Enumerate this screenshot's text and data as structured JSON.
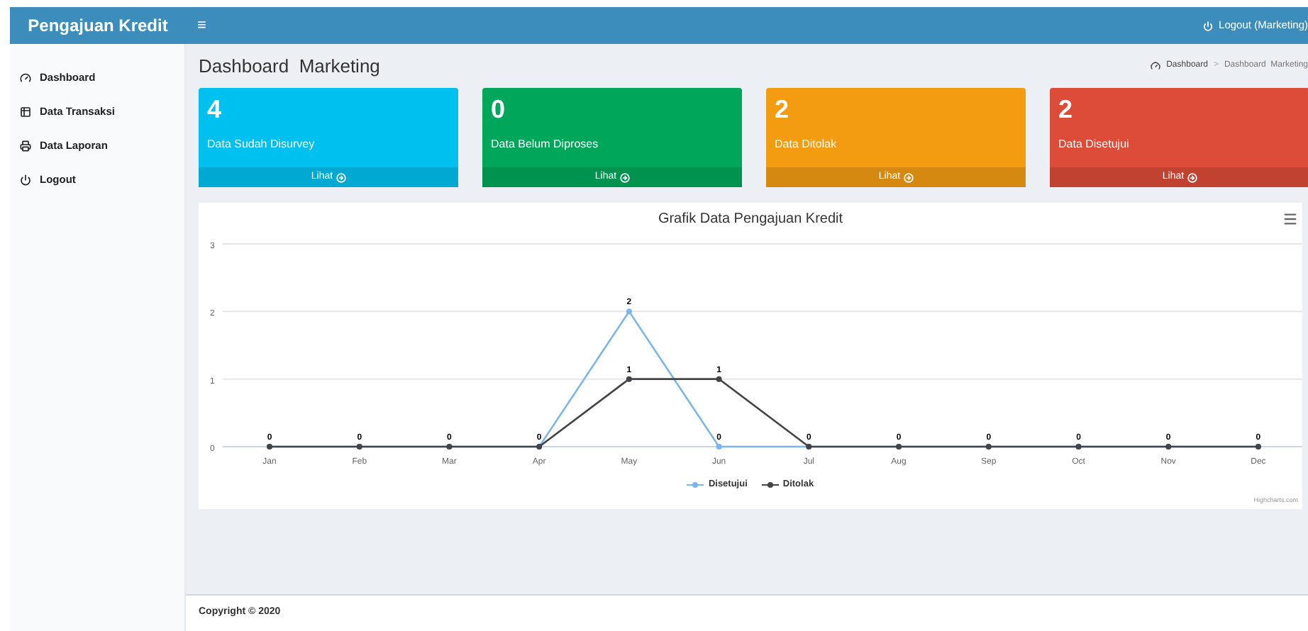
{
  "header": {
    "brand": "Pengajuan Kredit",
    "menu_toggle": "≡",
    "logout": "Logout (Marketing)"
  },
  "sidebar": {
    "items": [
      {
        "label": "Dashboard"
      },
      {
        "label": "Data Transaksi"
      },
      {
        "label": "Data Laporan"
      },
      {
        "label": "Logout"
      }
    ]
  },
  "page": {
    "title": "Dashboard  Marketing",
    "breadcrumb": [
      "Dashboard",
      "Dashboard  Marketing"
    ],
    "breadcrumb_separator": ">"
  },
  "cards": [
    {
      "value": "4",
      "label": "Data Sudah Disurvey",
      "link": "Lihat",
      "color": "#00c0ef"
    },
    {
      "value": "0",
      "label": "Data Belum Diproses",
      "link": "Lihat",
      "color": "#00a65a"
    },
    {
      "value": "2",
      "label": "Data Ditolak",
      "link": "Lihat",
      "color": "#f39c12"
    },
    {
      "value": "2",
      "label": "Data Disetujui",
      "link": "Lihat",
      "color": "#dd4b39"
    }
  ],
  "chart": {
    "credits": "Highcharts.com",
    "chart_data": {
      "type": "line",
      "title": "Grafik Data Pengajuan Kredit",
      "categories": [
        "Jan",
        "Feb",
        "Mar",
        "Apr",
        "May",
        "Jun",
        "Jul",
        "Aug",
        "Sep",
        "Oct",
        "Nov",
        "Dec"
      ],
      "ylim": [
        0,
        3
      ],
      "yticks": [
        0,
        1,
        2,
        3
      ],
      "series": [
        {
          "name": "Disetujui",
          "color": "#7cb5ec",
          "marker": "circle",
          "values": [
            0,
            0,
            0,
            0,
            2,
            0,
            0,
            0,
            0,
            0,
            0,
            0
          ],
          "value_labels": [
            "0",
            "0",
            "0",
            "0",
            "2",
            "0",
            "0",
            "0",
            "0",
            "0",
            "0",
            "0"
          ]
        },
        {
          "name": "Ditolak",
          "color": "#434348",
          "marker": "circle",
          "values": [
            0,
            0,
            0,
            0,
            1,
            1,
            0,
            0,
            0,
            0,
            0,
            0
          ],
          "value_labels": [
            null,
            null,
            null,
            null,
            "1",
            "1",
            null,
            null,
            null,
            null,
            null,
            null
          ]
        }
      ]
    }
  },
  "footer": {
    "copyright": "Copyright © 2020"
  }
}
